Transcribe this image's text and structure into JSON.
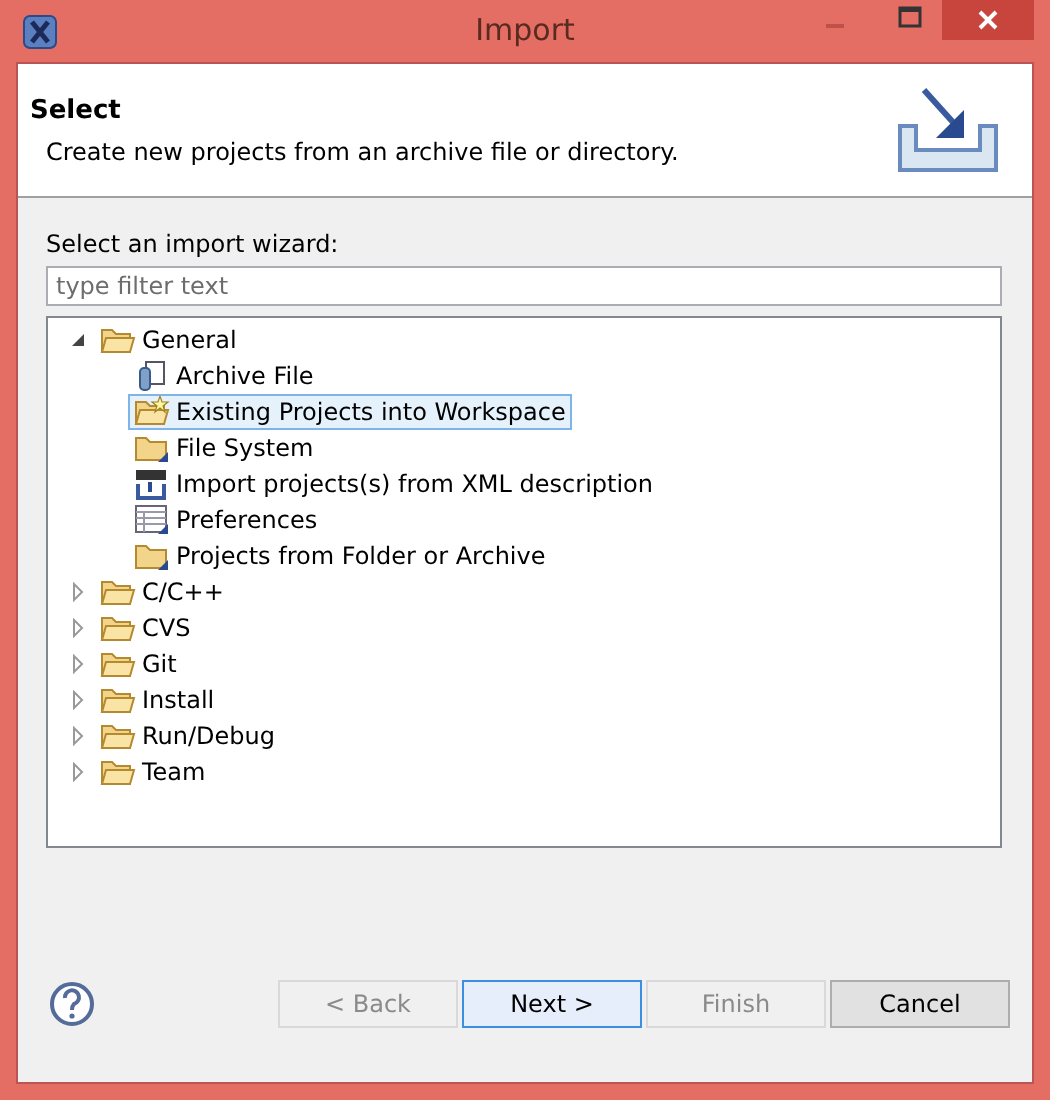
{
  "window": {
    "title": "Import"
  },
  "header": {
    "title": "Select",
    "description": "Create new projects from an archive file or directory."
  },
  "wizard_label": "Select an import wizard:",
  "filter": {
    "placeholder": "type filter text"
  },
  "tree": [
    {
      "label": "General",
      "expanded": true,
      "children": [
        {
          "label": "Archive File",
          "kind": "archive",
          "selected": false
        },
        {
          "label": "Existing Projects into Workspace",
          "kind": "project",
          "selected": true
        },
        {
          "label": "File System",
          "kind": "folder",
          "selected": false
        },
        {
          "label": "Import projects(s) from XML description",
          "kind": "xml",
          "selected": false
        },
        {
          "label": "Preferences",
          "kind": "prefs",
          "selected": false
        },
        {
          "label": "Projects from Folder or Archive",
          "kind": "folder",
          "selected": false
        }
      ]
    },
    {
      "label": "C/C++",
      "expanded": false
    },
    {
      "label": "CVS",
      "expanded": false
    },
    {
      "label": "Git",
      "expanded": false
    },
    {
      "label": "Install",
      "expanded": false
    },
    {
      "label": "Run/Debug",
      "expanded": false
    },
    {
      "label": "Team",
      "expanded": false
    }
  ],
  "buttons": [
    {
      "label": "< Back",
      "disabled": true,
      "default": false
    },
    {
      "label": "Next >",
      "disabled": false,
      "default": true
    },
    {
      "label": "Finish",
      "disabled": true,
      "default": false
    },
    {
      "label": "Cancel",
      "disabled": false,
      "default": false
    }
  ]
}
